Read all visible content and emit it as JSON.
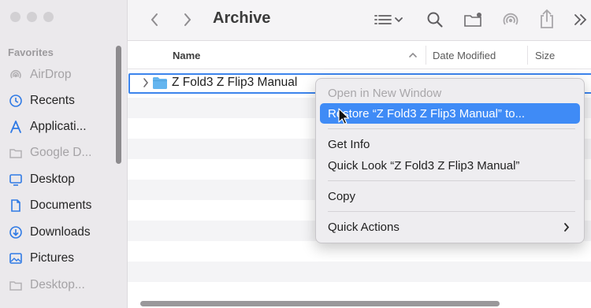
{
  "window": {
    "title": "Archive"
  },
  "sidebar": {
    "section": "Favorites",
    "items": [
      {
        "label": "AirDrop",
        "icon": "airdrop-icon",
        "dim": true
      },
      {
        "label": "Recents",
        "icon": "clock-icon",
        "dim": false
      },
      {
        "label": "Applicati...",
        "icon": "applications-icon",
        "dim": false
      },
      {
        "label": "Google D...",
        "icon": "folder-icon",
        "dim": true
      },
      {
        "label": "Desktop",
        "icon": "desktop-icon",
        "dim": false
      },
      {
        "label": "Documents",
        "icon": "document-icon",
        "dim": false
      },
      {
        "label": "Downloads",
        "icon": "download-icon",
        "dim": false
      },
      {
        "label": "Pictures",
        "icon": "pictures-icon",
        "dim": false
      },
      {
        "label": "Desktop...",
        "icon": "folder-icon",
        "dim": true
      }
    ]
  },
  "columns": {
    "name": "Name",
    "date_modified": "Date Modified",
    "size": "Size"
  },
  "files": [
    {
      "name": "Z Fold3 Z Flip3 Manual",
      "kind": "folder"
    }
  ],
  "context_menu": {
    "open_new_window": "Open in New Window",
    "restore": "Restore “Z Fold3 Z Flip3 Manual” to...",
    "get_info": "Get Info",
    "quick_look": "Quick Look “Z Fold3 Z Flip3 Manual”",
    "copy": "Copy",
    "quick_actions": "Quick Actions"
  },
  "colors": {
    "accent": "#3f8bf6",
    "selection_border": "#3c84ec",
    "sidebar_bg": "#ebe9ec"
  }
}
